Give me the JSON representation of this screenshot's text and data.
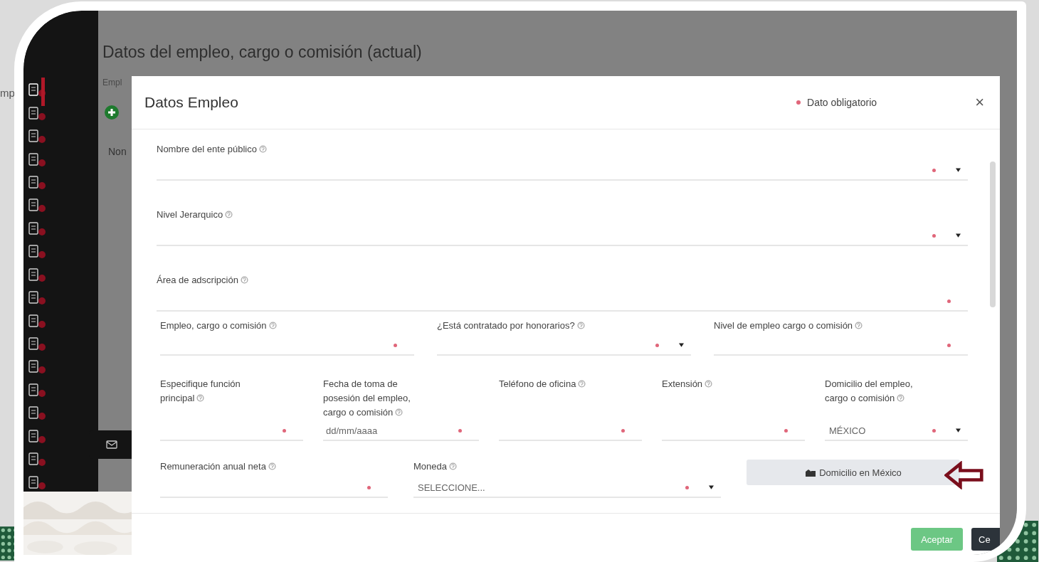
{
  "edge_text": "mp",
  "sidebar": {
    "items": [
      {
        "selected": true
      },
      {
        "selected": false
      },
      {
        "selected": false
      },
      {
        "selected": false
      },
      {
        "selected": false
      },
      {
        "selected": false
      },
      {
        "selected": false
      },
      {
        "selected": false
      },
      {
        "selected": false
      },
      {
        "selected": false
      },
      {
        "selected": false
      },
      {
        "selected": false
      },
      {
        "selected": false
      },
      {
        "selected": false
      },
      {
        "selected": false
      },
      {
        "selected": false
      },
      {
        "selected": false
      },
      {
        "selected": false
      }
    ]
  },
  "background": {
    "title": "Datos del empleo, cargo o comisión (actual)",
    "tab_label": "Empl",
    "column_header": "Non"
  },
  "modal": {
    "title": "Datos Empleo",
    "required_legend": "Dato obligatorio",
    "close": "×",
    "rows": [
      [
        {
          "kind": "select",
          "label": "Nombre del ente público",
          "help": true,
          "required": true
        }
      ],
      [
        {
          "kind": "select",
          "label": "Nivel Jerarquico",
          "help": true,
          "required": true
        }
      ],
      [
        {
          "kind": "text",
          "label": "Área de adscripción",
          "help": true,
          "required": true
        }
      ],
      [
        {
          "kind": "text",
          "label": "Empleo, cargo o comisión",
          "help": true,
          "required": true
        },
        {
          "kind": "select",
          "label": "¿Está contratado por honorarios?",
          "help": true,
          "required": true
        },
        {
          "kind": "text",
          "label": "Nivel de empleo cargo o comisión",
          "help": true,
          "required": true
        }
      ],
      [
        {
          "kind": "text",
          "label": "Especifique función principal",
          "help": true,
          "required": true
        },
        {
          "kind": "text",
          "label": "Fecha de toma de posesión del empleo, cargo o comisión",
          "help": true,
          "required": true,
          "placeholder": "dd/mm/aaaa"
        },
        {
          "kind": "text",
          "label": "Teléfono de oficina",
          "help": true,
          "required": true
        },
        {
          "kind": "text",
          "label": "Extensión",
          "help": true,
          "required": true
        },
        {
          "kind": "select",
          "label": "Domicilio del empleo, cargo o comisión",
          "help": true,
          "required": true,
          "value": "MÉXICO"
        }
      ],
      [
        {
          "kind": "text",
          "label": "Remuneración anual neta",
          "help": true,
          "required": true
        },
        {
          "kind": "select",
          "label": "Moneda",
          "help": true,
          "required": true,
          "value": "SELECCIONE..."
        },
        {
          "kind": "button",
          "label": "Domicilio en México"
        }
      ]
    ],
    "buttons": [
      {
        "label": "Aceptar",
        "kind": "primary"
      },
      {
        "label": "Ce",
        "kind": "dark"
      }
    ]
  }
}
